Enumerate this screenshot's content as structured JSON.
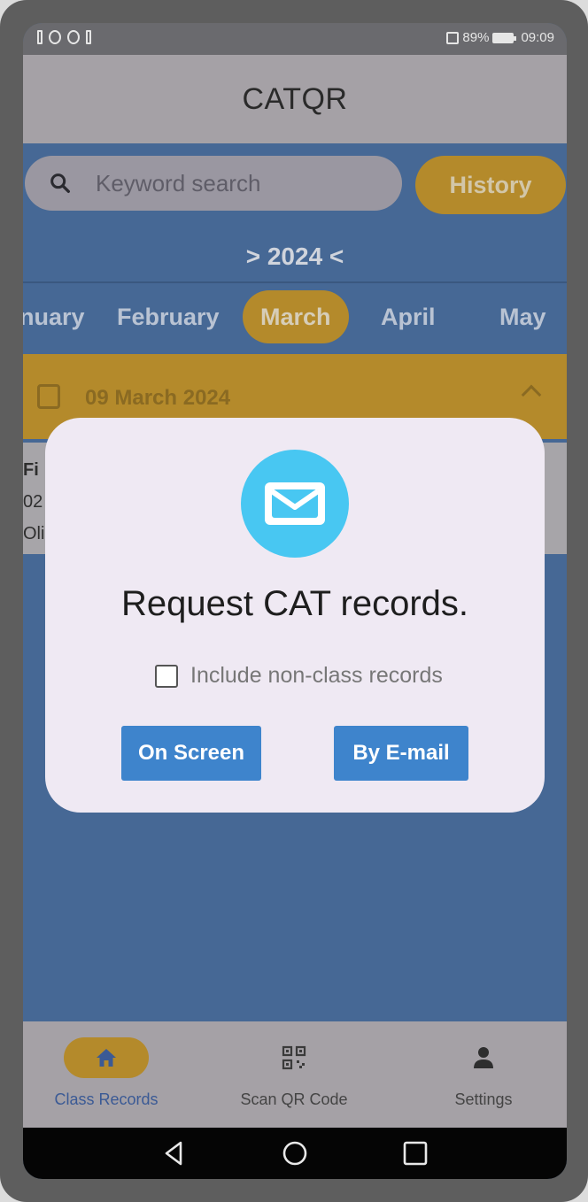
{
  "status_bar": {
    "battery": "89%",
    "time": "09:09"
  },
  "app_bar": {
    "title": "CATQR"
  },
  "search": {
    "placeholder": "Keyword search",
    "history_label": "History"
  },
  "calendar": {
    "year_label": "> 2024 <",
    "months": [
      "nuary",
      "February",
      "March",
      "April",
      "May"
    ],
    "selected_month": "March"
  },
  "background_list": {
    "date_header": "09 March 2024",
    "record_lines": [
      "Fi",
      "02",
      "Oli"
    ]
  },
  "dialog": {
    "title": "Request CAT records.",
    "checkbox_label": "Include non-class records",
    "checkbox_checked": false,
    "on_screen_label": "On Screen",
    "email_label": "By E-mail"
  },
  "bottom_nav": {
    "items": [
      {
        "label": "Class Records",
        "icon": "home-icon",
        "active": true
      },
      {
        "label": "Scan QR Code",
        "icon": "qr-code-icon",
        "active": false
      },
      {
        "label": "Settings",
        "icon": "person-icon",
        "active": false
      }
    ]
  },
  "colors": {
    "background_blue": "#466895",
    "accent_gold": "#b48a2b",
    "mail_circle": "#48c7f2",
    "button_blue": "#3e84cc"
  }
}
